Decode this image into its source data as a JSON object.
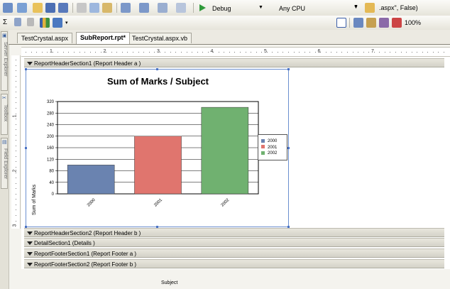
{
  "toolbar": {
    "config_value": "Debug",
    "platform_value": "Any CPU",
    "code_fragment": ".aspx\", False)",
    "zoom_value": "100%"
  },
  "side_tabs": [
    "Server Explorer",
    "Toolbox",
    "Field Explorer"
  ],
  "tabs": [
    {
      "label": "TestCrystal.aspx",
      "active": false
    },
    {
      "label": "SubReport.rpt*",
      "active": true
    },
    {
      "label": "TestCrystal.aspx.vb",
      "active": false
    }
  ],
  "ruler": {
    "numbers": [
      "1",
      "2",
      "3",
      "4",
      "5",
      "6",
      "7"
    ],
    "vnumbers": [
      "1",
      "2",
      "3"
    ]
  },
  "sections": [
    "ReportHeaderSection1 (Report Header a )",
    "ReportHeaderSection2 (Report Header b )",
    "DetailSection1 (Details  )",
    "ReportFooterSection1 (Report Footer a )",
    "ReportFooterSection2 (Report Footer b )"
  ],
  "chart_data": {
    "type": "bar",
    "title": "Sum of Marks / Subject",
    "xlabel": "Subject",
    "ylabel": "Sum of Marks",
    "categories": [
      "2000",
      "2001",
      "2002"
    ],
    "values": [
      100,
      200,
      300
    ],
    "colors": [
      "#6a83b0",
      "#e0756e",
      "#70b170"
    ],
    "yticks": [
      0,
      40,
      80,
      120,
      160,
      200,
      240,
      280,
      320
    ],
    "ylim": [
      0,
      320
    ],
    "grid": true,
    "legend": {
      "position": "right",
      "items": [
        {
          "label": "2000",
          "color": "#6a83b0"
        },
        {
          "label": "2001",
          "color": "#e0756e"
        },
        {
          "label": "2002",
          "color": "#70b170"
        }
      ]
    }
  }
}
